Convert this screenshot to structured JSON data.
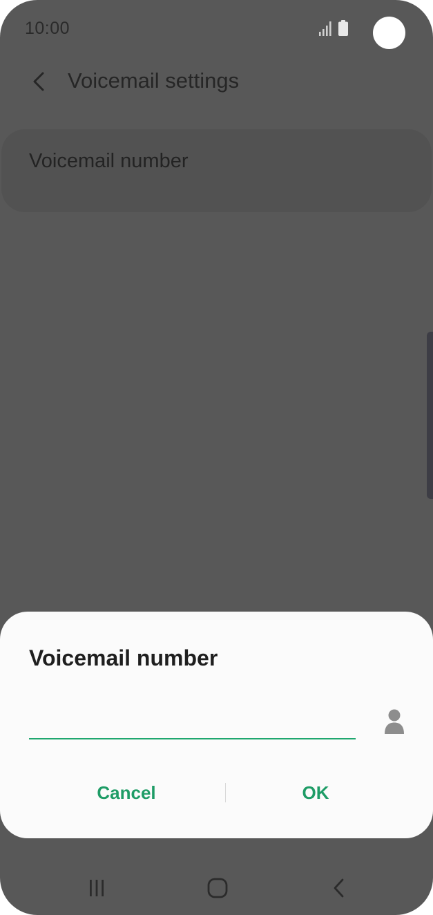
{
  "status_bar": {
    "time": "10:00",
    "signal_icon": "signal-bars-icon",
    "battery_icon": "battery-icon"
  },
  "header": {
    "back_icon": "chevron-left-icon",
    "title": "Voicemail settings"
  },
  "settings": {
    "items": [
      {
        "label": "Voicemail number"
      }
    ]
  },
  "dialog": {
    "title": "Voicemail number",
    "input_value": "",
    "contacts_icon": "person-icon",
    "cancel_label": "Cancel",
    "ok_label": "OK"
  },
  "nav_bar": {
    "recents_icon": "recents-icon",
    "home_icon": "home-icon",
    "back_icon": "back-icon"
  },
  "colors": {
    "accent": "#1fa76f",
    "button_text": "#1e9c66",
    "scrim_background": "#585858",
    "dialog_background": "#fbfbfb"
  }
}
